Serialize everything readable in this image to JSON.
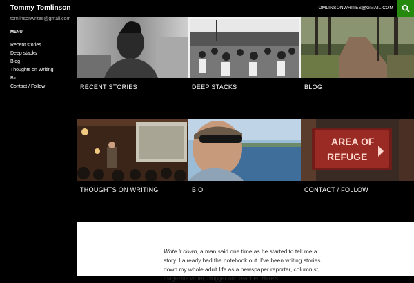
{
  "header": {
    "site_title": "Tommy Tomlinson",
    "email": "TOMLINSONWRITES@GMAIL.COM"
  },
  "sidebar": {
    "description": "tomlinsonwrites@gmail.com",
    "menu_heading": "MENU",
    "items": [
      {
        "label": "Recent stories"
      },
      {
        "label": "Deep stacks"
      },
      {
        "label": "Blog"
      },
      {
        "label": "Thoughts on Writing"
      },
      {
        "label": "Bio"
      },
      {
        "label": "Contact / Follow"
      }
    ]
  },
  "tiles": [
    {
      "label": "RECENT STORIES"
    },
    {
      "label": "DEEP STACKS"
    },
    {
      "label": "BLOG"
    },
    {
      "label": "THOUGHTS ON WRITING"
    },
    {
      "label": "BIO"
    },
    {
      "label": "CONTACT / FOLLOW"
    }
  ],
  "sign_text": {
    "line1": "AREA OF",
    "line2": "REFUGE"
  },
  "intro": {
    "italic": "Write it down,",
    "text": " a man said one time as he started to tell me a story. I already had the notebook out. I’ve been writing stories down my whole adult life as a newspaper reporter, columnist, magazine writer, blogger and teacher. Here’s"
  },
  "colors": {
    "accent": "#24890d",
    "background": "#000000"
  }
}
